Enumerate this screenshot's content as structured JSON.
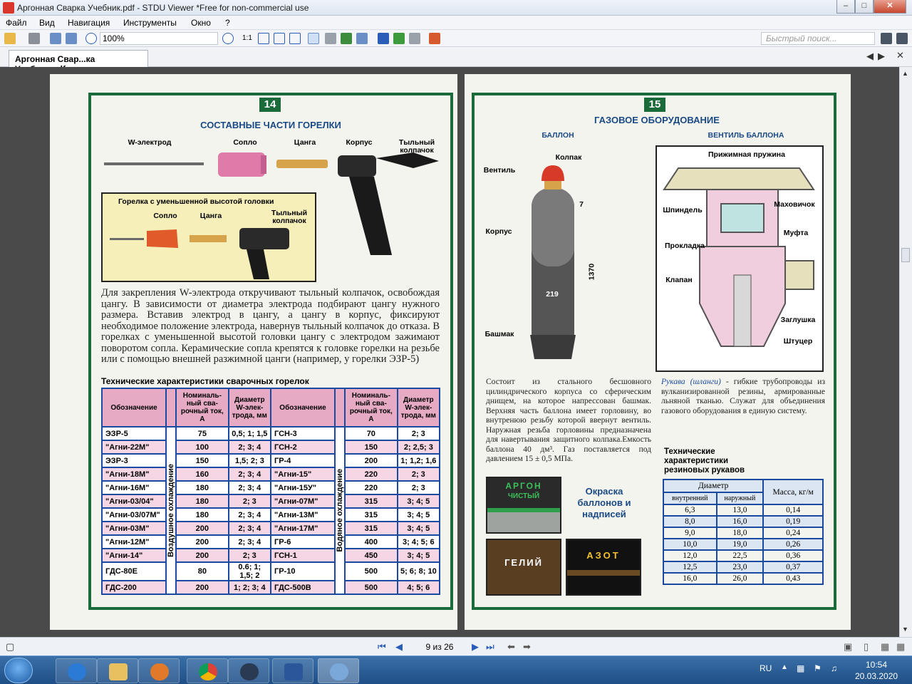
{
  "window": {
    "title": "Аргонная Сварка Учебник.pdf - STDU Viewer *Free for non-commercial use"
  },
  "menu": [
    "Файл",
    "Вид",
    "Навигация",
    "Инструменты",
    "Окно",
    "?"
  ],
  "toolbar": {
    "zoom": "100%",
    "search_placeholder": "Быстрый поиск...",
    "fit_label": "1:1"
  },
  "tab": {
    "label": "Аргонная Свар...ка Учебник.pdf"
  },
  "status": {
    "page_indicator": "9 из 26"
  },
  "taskbar": {
    "lang": "RU",
    "time": "10:54",
    "date": "20.03.2020"
  },
  "left_page": {
    "number": "14",
    "title": "СОСТАВНЫЕ ЧАСТИ ГОРЕЛКИ",
    "parts": [
      "W-электрод",
      "Сопло",
      "Цанга",
      "Корпус",
      "Тыльный колпачок"
    ],
    "inset_title": "Горелка с уменьшенной высотой головки",
    "inset_parts": [
      "Сопло",
      "Цанга",
      "Тыльный колпачок"
    ],
    "paragraph": "Для закрепления W-электрода откручивают тыльный колпачок, освобождая цангу. В зависимости от диаметра электрода подбирают цангу нужного размера. Вставив электрод в цангу, а цангу в корпус, фиксируют необходимое положение электрода, навернув тыльный колпачок до отказа. В горелках с уменьшенной высотой головки цангу с электродом зажимают поворотом сопла. Керамические сопла крепятся к головке горелки на резьбе или с помощью внешней разжимной цанги (например, у горелки ЭЗР-5)",
    "table_title": "Технические характеристики сварочных горелок",
    "table_headers": [
      "Обозначение",
      "Номиналь-ный сва-рочный ток, А",
      "Диаметр W-элек-трода, мм",
      "Обозначение",
      "Номиналь-ный сва-рочный ток, А",
      "Диаметр W-элек-трода, мм"
    ],
    "air_label": "Воздушное охлаждение",
    "water_label": "Водяное охлаждение",
    "rows": [
      [
        "ЭЗР-5",
        "75",
        "0,5; 1; 1,5",
        "ГСН-3",
        "70",
        "2; 3"
      ],
      [
        "\"Агни-22М\"",
        "100",
        "2; 3; 4",
        "ГСН-2",
        "150",
        "2; 2,5; 3"
      ],
      [
        "ЭЗР-3",
        "150",
        "1,5; 2; 3",
        "ГР-4",
        "200",
        "1; 1,2; 1,6"
      ],
      [
        "\"Агни-18М\"",
        "160",
        "2; 3; 4",
        "\"Агни-15\"",
        "220",
        "2; 3"
      ],
      [
        "\"Агни-16М\"",
        "180",
        "2; 3; 4",
        "\"Агни-15У\"",
        "220",
        "2; 3"
      ],
      [
        "\"Агни-03/04\"",
        "180",
        "2; 3",
        "\"Агни-07М\"",
        "315",
        "3; 4; 5"
      ],
      [
        "\"Агни-03/07М\"",
        "180",
        "2; 3; 4",
        "\"Агни-13М\"",
        "315",
        "3; 4; 5"
      ],
      [
        "\"Агни-03М\"",
        "200",
        "2; 3; 4",
        "\"Агни-17М\"",
        "315",
        "3; 4; 5"
      ],
      [
        "\"Агни-12М\"",
        "200",
        "2; 3; 4",
        "ГР-6",
        "400",
        "3; 4; 5; 6"
      ],
      [
        "\"Агни-14\"",
        "200",
        "2; 3",
        "ГСН-1",
        "450",
        "3; 4; 5"
      ],
      [
        "ГДС-80Е",
        "80",
        "0.6; 1; 1,5; 2",
        "ГР-10",
        "500",
        "5; 6; 8; 10"
      ],
      [
        "ГДС-200",
        "200",
        "1; 2; 3; 4",
        "ГДС-500В",
        "500",
        "4; 5; 6"
      ]
    ]
  },
  "right_page": {
    "number": "15",
    "title": "ГАЗОВОЕ ОБОРУДОВАНИЕ",
    "cyl_title": "БАЛЛОН",
    "valve_title": "ВЕНТИЛЬ БАЛЛОНА",
    "cyl_labels": [
      "Колпак",
      "Вентиль",
      "Корпус",
      "Башмак"
    ],
    "cyl_dims": [
      "7",
      "219",
      "1370"
    ],
    "valve_labels": [
      "Прижимная пружина",
      "Шпиндель",
      "Маховичок",
      "Муфта",
      "Прокладка",
      "Клапан",
      "Заглушка",
      "Штуцер"
    ],
    "cyl_paragraph": "Состоит из стального бесшовного цилиндрического корпуса со сферическим днищем, на которое напрессован башмак. Верхняя часть баллона имеет горловину, во внутренюю резьбу которой ввернут вентиль. Наружная резьба горловины предназначена для навертывания защитного колпака.Емкость баллона 40 дм³. Газ поставляется под давлением 15 ± 0,5 МПа.",
    "hose_italic": "Рукава (шланги)",
    "hose_paragraph": " - гибкие трубопроводы из вулканизированной резины, армированные льняной тканью. Служат для объединения газового оборудования в единую систему.",
    "paint_label": "Окраска баллонов и надписей",
    "argon_line1": "АРГОН",
    "argon_line2": "ЧИСТЫЙ",
    "helium": "ГЕЛИЙ",
    "nitrogen": "АЗОТ",
    "hose_table_title": "Технические характеристики резиновых рукавов",
    "hose_headers": {
      "diameter": "Диаметр",
      "inner": "внутренний",
      "outer": "наружный",
      "mass": "Масса, кг/м"
    },
    "hose_rows": [
      [
        "6,3",
        "13,0",
        "0,14"
      ],
      [
        "8,0",
        "16,0",
        "0,19"
      ],
      [
        "9,0",
        "18,0",
        "0,24"
      ],
      [
        "10,0",
        "19,0",
        "0,26"
      ],
      [
        "12,0",
        "22,5",
        "0,36"
      ],
      [
        "12,5",
        "23,0",
        "0,37"
      ],
      [
        "16,0",
        "26,0",
        "0,43"
      ]
    ]
  }
}
